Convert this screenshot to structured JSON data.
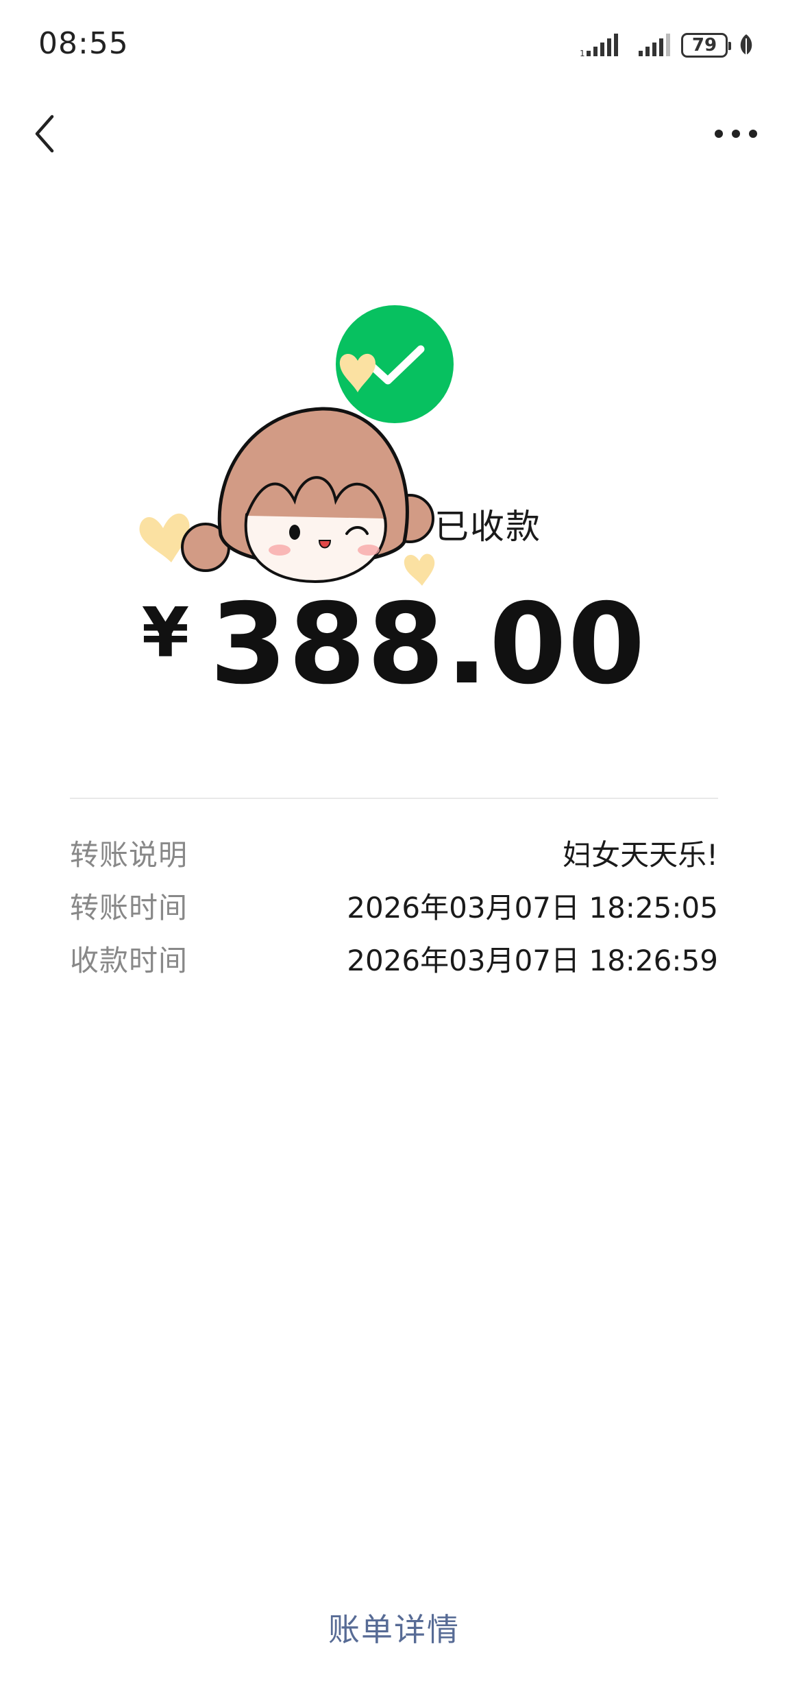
{
  "status_bar": {
    "time": "08:55",
    "battery": "79",
    "icons": [
      "signal-strength-icon",
      "signal-strength-icon",
      "battery-icon",
      "leaf-icon"
    ]
  },
  "nav": {
    "back_icon": "chevron-left-icon",
    "more_icon": "more-dots-icon"
  },
  "receipt": {
    "status_icon": "checkmark-circle-icon",
    "status_color": "#07c160",
    "status_label": "已收款",
    "currency": "¥",
    "amount": "388.00"
  },
  "details": [
    {
      "label": "转账说明",
      "value": "妇女天天乐!"
    },
    {
      "label": "转账时间",
      "value": "2026年03月07日 18:25:05"
    },
    {
      "label": "收款时间",
      "value": "2026年03月07日 18:26:59"
    }
  ],
  "footer": {
    "bill_details_link": "账单详情",
    "link_color": "#576b95"
  }
}
